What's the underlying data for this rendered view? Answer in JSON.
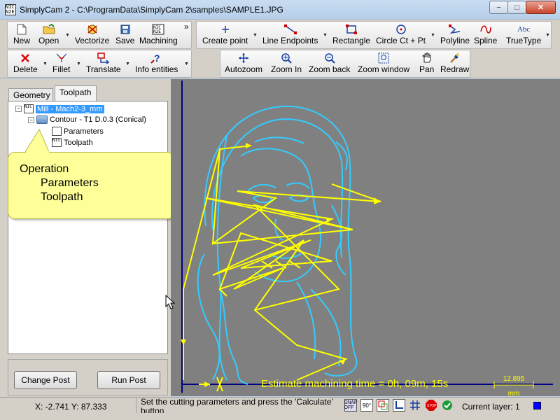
{
  "window": {
    "title": "SimplyCam 2 - C:\\ProgramData\\SimplyCam 2\\samples\\SAMPLE1.JPG",
    "min_label": "−",
    "max_label": "□",
    "close_label": "✕"
  },
  "toolbar1": {
    "buttons": [
      {
        "label": "New",
        "icon": "new-file-icon"
      },
      {
        "label": "Open",
        "icon": "open-folder-icon"
      },
      {
        "label": "Vectorize",
        "icon": "vectorize-icon"
      },
      {
        "label": "Save",
        "icon": "save-disk-icon"
      },
      {
        "label": "Machining",
        "icon": "machining-icon"
      }
    ],
    "overflow": "»"
  },
  "toolbar2": {
    "buttons": [
      {
        "label": "Create point",
        "icon": "point-icon"
      },
      {
        "label": "Line Endpoints",
        "icon": "line-icon"
      },
      {
        "label": "Rectangle",
        "icon": "rectangle-icon"
      },
      {
        "label": "Circle Ct + Pt",
        "icon": "circle-icon"
      },
      {
        "label": "Polyline",
        "icon": "polyline-icon"
      },
      {
        "label": "Spline",
        "icon": "spline-icon"
      },
      {
        "label": "TrueType",
        "icon": "truetype-icon"
      }
    ],
    "truetype_icon_text": "Abc"
  },
  "toolbar3": {
    "buttons": [
      {
        "label": "Delete",
        "icon": "delete-x-icon"
      },
      {
        "label": "Fillet",
        "icon": "fillet-icon"
      },
      {
        "label": "Translate",
        "icon": "translate-icon"
      },
      {
        "label": "Info entities",
        "icon": "info-icon"
      }
    ]
  },
  "toolbar4": {
    "buttons": [
      {
        "label": "Autozoom",
        "icon": "autozoom-icon"
      },
      {
        "label": "Zoom In",
        "icon": "zoom-in-icon"
      },
      {
        "label": "Zoom back",
        "icon": "zoom-back-icon"
      },
      {
        "label": "Zoom window",
        "icon": "zoom-window-icon"
      },
      {
        "label": "Pan",
        "icon": "pan-hand-icon"
      },
      {
        "label": "Redraw",
        "icon": "redraw-icon"
      }
    ]
  },
  "left_panel": {
    "tabs": [
      "Geometry",
      "Toolpath"
    ],
    "active_tab": "Toolpath",
    "tree": {
      "root": "Mill - Mach2-3_mm",
      "contour": "Contour - T1 D.0.3 (Conical)",
      "parameters": "Parameters",
      "toolpath": "Toolpath"
    },
    "callout": {
      "line1": "Operation",
      "line2": "Parameters",
      "line3": "Toolpath"
    },
    "buttons": {
      "change_post": "Change Post",
      "run_post": "Run Post"
    }
  },
  "canvas": {
    "background": "#808080",
    "geometry_color": "#33ccff",
    "toolpath_color": "#ffff00",
    "axis_color": "#000080",
    "estimate": "Estimate machining time = 0h, 09m, 15s",
    "scale_value": "12.895",
    "scale_unit": "mm"
  },
  "status": {
    "coords": "X: -2.741 Y: 87.333",
    "message": "Set the cutting parameters and press the 'Calculate' button",
    "layer": "Current layer: 1",
    "layer_color": "#0000ff",
    "icons": [
      "snap-off-icon",
      "angle-90-icon",
      "layers-icon",
      "axes-icon",
      "grid-icon",
      "stop-icon",
      "check-icon"
    ],
    "snap_label": "SNAP OFF",
    "angle_label": "90°"
  }
}
